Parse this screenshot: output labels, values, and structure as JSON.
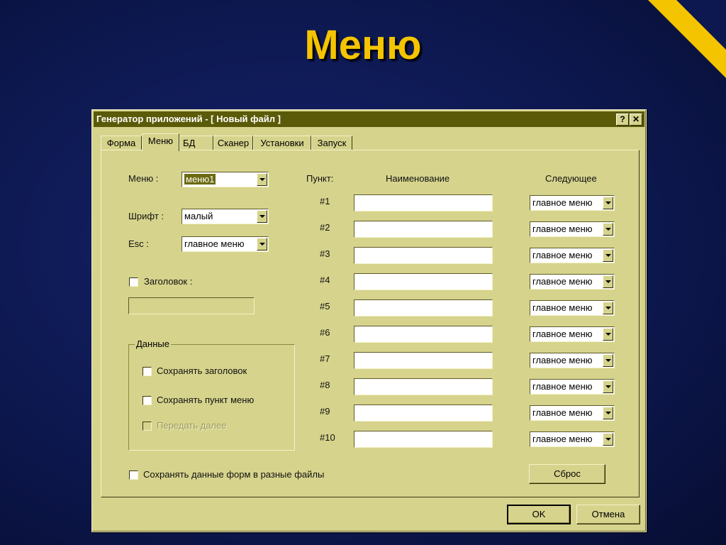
{
  "slide": {
    "title": "Меню"
  },
  "window": {
    "title": "Генератор приложений - [ Новый файл ]",
    "help_label": "?",
    "close_label": "✕"
  },
  "tabs": [
    {
      "label": "Форма"
    },
    {
      "label": "Меню",
      "active": true
    },
    {
      "label": "БД"
    },
    {
      "label": "Сканер"
    },
    {
      "label": "Установки"
    },
    {
      "label": "Запуск"
    }
  ],
  "left": {
    "menu_label": "Меню :",
    "menu_value": "меню1",
    "font_label": "Шрифт :",
    "font_value": "малый",
    "esc_label": "Esc :",
    "esc_value": "главное меню",
    "header_checkbox_label": "Заголовок :",
    "header_value": "",
    "data_group": {
      "title": "Данные",
      "save_header": "Сохранять заголовок",
      "save_item": "Сохранять пункт меню",
      "pass_further": "Передать далее"
    },
    "save_forms_label": "Сохранять данные форм в разные файлы"
  },
  "grid": {
    "col_item": "Пункт:",
    "col_name": "Наименование",
    "col_next": "Следующее",
    "rows": [
      {
        "num": "#1",
        "name": "",
        "next": "главное меню"
      },
      {
        "num": "#2",
        "name": "",
        "next": "главное меню"
      },
      {
        "num": "#3",
        "name": "",
        "next": "главное меню"
      },
      {
        "num": "#4",
        "name": "",
        "next": "главное меню"
      },
      {
        "num": "#5",
        "name": "",
        "next": "главное меню"
      },
      {
        "num": "#6",
        "name": "",
        "next": "главное меню"
      },
      {
        "num": "#7",
        "name": "",
        "next": "главное меню"
      },
      {
        "num": "#8",
        "name": "",
        "next": "главное меню"
      },
      {
        "num": "#9",
        "name": "",
        "next": "главное меню"
      },
      {
        "num": "#10",
        "name": "",
        "next": "главное меню"
      }
    ]
  },
  "buttons": {
    "reset": "Сброс",
    "ok": "OK",
    "cancel": "Отмена"
  },
  "colors": {
    "accent": "#f5c400",
    "titlebar": "#5a5a08",
    "dialog": "#d6d38c"
  }
}
